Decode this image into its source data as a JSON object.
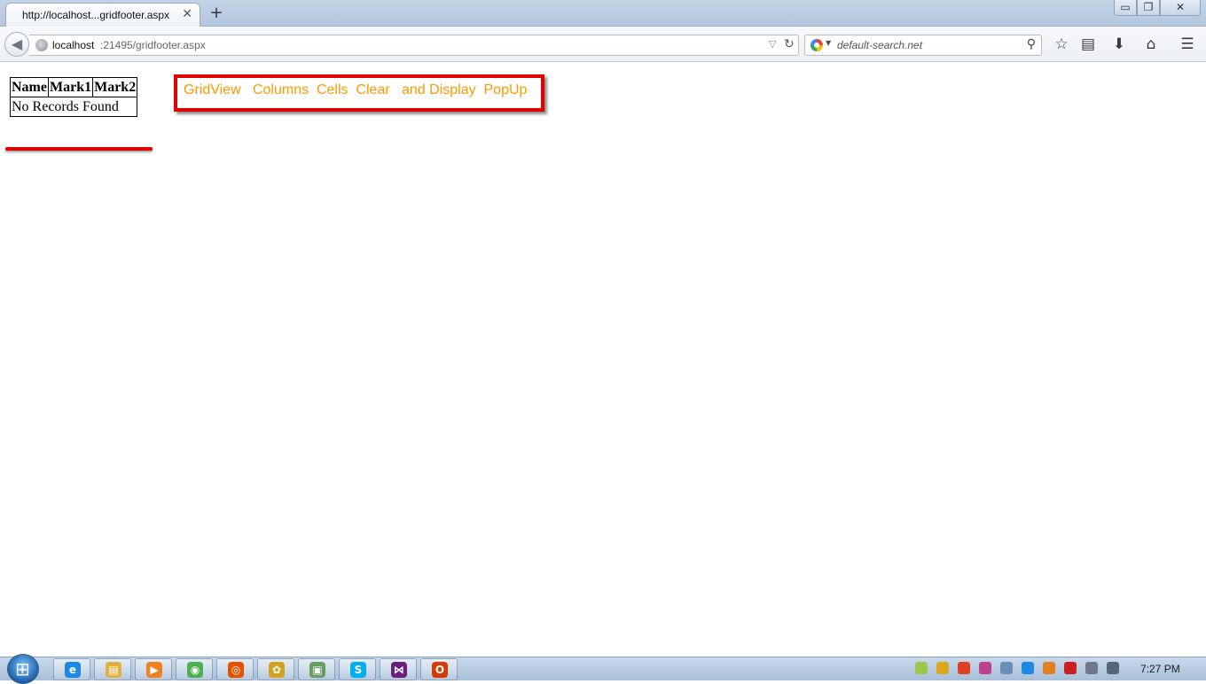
{
  "browser": {
    "tab_title": "http://localhost...gridfooter.aspx",
    "tab_close": "✕",
    "new_tab": "+",
    "url_host": "localhost",
    "url_path": ":21495/gridfooter.aspx",
    "search_placeholder": "default-search.net",
    "window_controls": {
      "minimize": "▭",
      "restore": "❐",
      "close": "✕"
    }
  },
  "page": {
    "grid": {
      "headers": [
        "Name",
        "Mark1",
        "Mark2"
      ],
      "empty_text": "No Records Found"
    },
    "popup_text": "GridView   Columns  Cells  Clear   and Display  PopUp",
    "accent_color": "#e00000",
    "link_color": "#ff9900"
  },
  "taskbar": {
    "apps": [
      {
        "icon": "internet-explorer-icon",
        "glyph": "e",
        "color": "#1e88e5"
      },
      {
        "icon": "file-explorer-icon",
        "glyph": "▤",
        "color": "#e0b040"
      },
      {
        "icon": "media-player-icon",
        "glyph": "▶",
        "color": "#f08020"
      },
      {
        "icon": "chrome-icon",
        "glyph": "◉",
        "color": "#4caf50"
      },
      {
        "icon": "firefox-icon",
        "glyph": "◎",
        "color": "#e65100"
      },
      {
        "icon": "paint-icon",
        "glyph": "✿",
        "color": "#d4a020"
      },
      {
        "icon": "photos-icon",
        "glyph": "▣",
        "color": "#66a060"
      },
      {
        "icon": "skype-icon",
        "glyph": "S",
        "color": "#00aff0"
      },
      {
        "icon": "visual-studio-icon",
        "glyph": "⋈",
        "color": "#68217a"
      },
      {
        "icon": "office-icon",
        "glyph": "O",
        "color": "#d83b01"
      }
    ],
    "clock": "7:27 PM"
  }
}
